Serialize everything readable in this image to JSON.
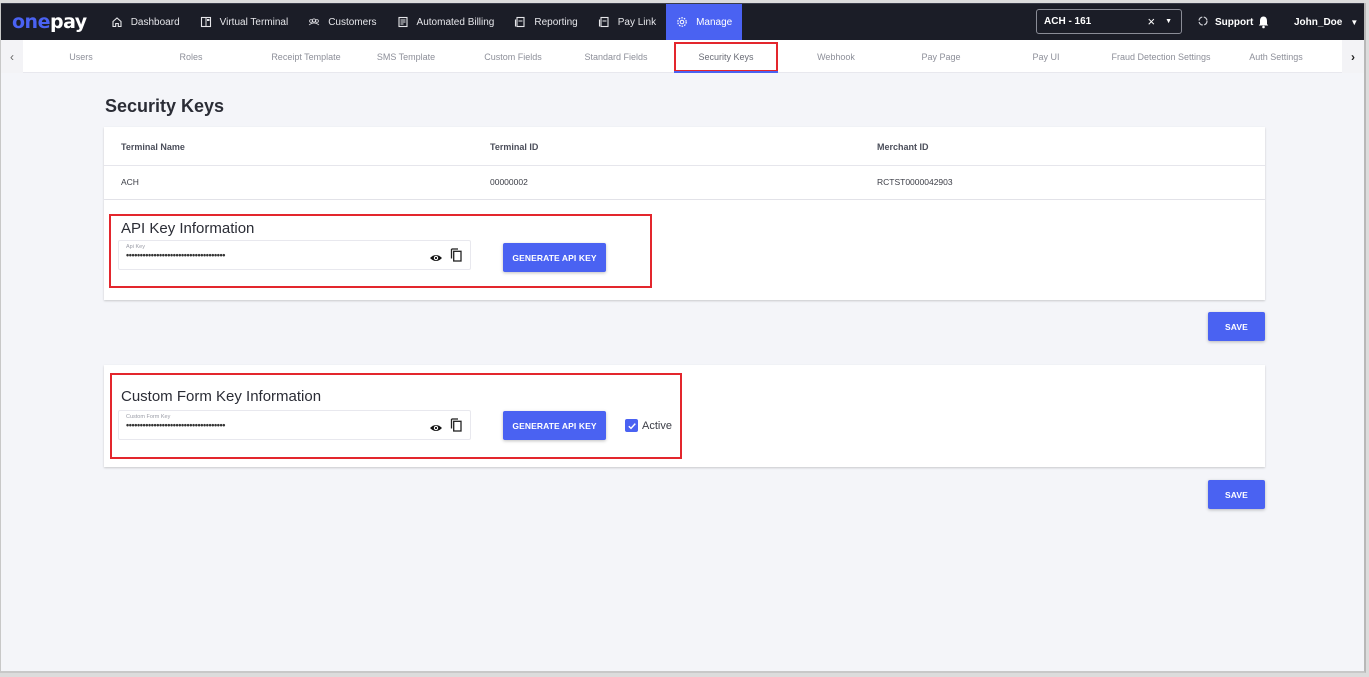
{
  "brand": {
    "logo_part1": "one",
    "logo_part2": "pay",
    "accent": "#4a62f2",
    "highlight": "#e3262d"
  },
  "topnav": {
    "items": [
      {
        "label": "Dashboard",
        "icon": "home-icon"
      },
      {
        "label": "Virtual Terminal",
        "icon": "terminal-icon"
      },
      {
        "label": "Customers",
        "icon": "customers-icon"
      },
      {
        "label": "Automated Billing",
        "icon": "billing-icon"
      },
      {
        "label": "Reporting",
        "icon": "report-icon"
      },
      {
        "label": "Pay Link",
        "icon": "paylink-icon"
      },
      {
        "label": "Manage",
        "icon": "gear-icon",
        "active": true
      }
    ],
    "terminal_select": {
      "value": "ACH - 161",
      "clear": "×",
      "caret": "▼"
    },
    "support_label": "Support",
    "user_name": "John_Doe"
  },
  "subnav": {
    "prev": "‹",
    "next": "›",
    "tabs": [
      {
        "label": "Users"
      },
      {
        "label": "Roles"
      },
      {
        "label": "Receipt Template"
      },
      {
        "label": "SMS Template"
      },
      {
        "label": "Custom Fields"
      },
      {
        "label": "Standard Fields"
      },
      {
        "label": "Security Keys",
        "active": true
      },
      {
        "label": "Webhook"
      },
      {
        "label": "Pay Page"
      },
      {
        "label": "Pay UI"
      },
      {
        "label": "Fraud Detection Settings"
      },
      {
        "label": "Auth Settings"
      }
    ]
  },
  "page": {
    "title": "Security Keys",
    "table": {
      "headers": [
        "Terminal Name",
        "Terminal ID",
        "Merchant ID"
      ],
      "row": [
        "ACH",
        "00000002",
        "RCTST0000042903"
      ]
    },
    "api_key_section": {
      "title": "API Key Information",
      "field_label": "Api Key",
      "field_value": "••••••••••••••••••••••••••••••••••••",
      "generate_label": "GENERATE API KEY",
      "save_label": "SAVE"
    },
    "custom_form_section": {
      "title": "Custom Form Key Information",
      "field_label": "Custom Form Key",
      "field_value": "••••••••••••••••••••••••••••••••••••",
      "generate_label": "GENERATE API KEY",
      "active_label": "Active",
      "active_checked": true,
      "save_label": "SAVE"
    }
  }
}
